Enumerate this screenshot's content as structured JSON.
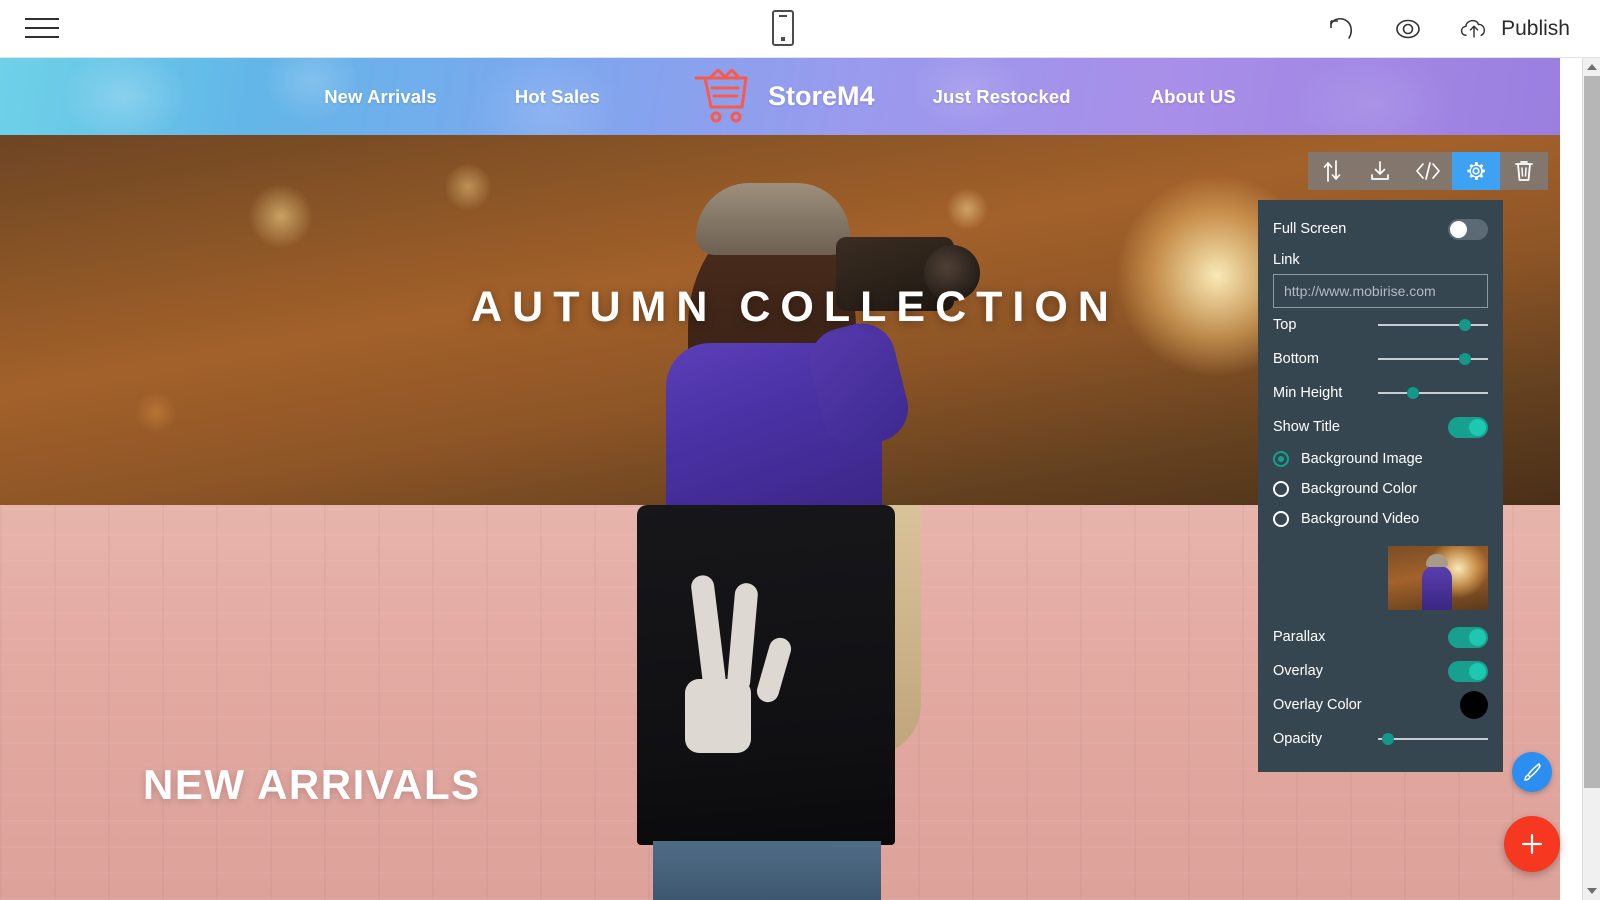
{
  "appbar": {
    "menu_icon": "hamburger-icon",
    "device_icon": "mobile-device-icon",
    "undo_icon": "undo-icon",
    "preview_icon": "eye-preview-icon",
    "publish_icon": "cloud-upload-icon",
    "publish_label": "Publish"
  },
  "sitenav": {
    "brand": "StoreM4",
    "brand_icon": "shopping-cart-icon",
    "brand_color": "#fb5a4a",
    "links_left": [
      "New Arrivals",
      "Hot Sales"
    ],
    "links_right": [
      "Just Restocked",
      "About US"
    ]
  },
  "hero": {
    "title": "AUTUMN COLLECTION",
    "selection_color": "#16a598"
  },
  "arrivals": {
    "title": "NEW ARRIVALS"
  },
  "block_toolbar": {
    "items": [
      {
        "name": "move-block-icon",
        "label": "Move Block",
        "active": false
      },
      {
        "name": "download-block-icon",
        "label": "Download Block",
        "active": false
      },
      {
        "name": "code-editor-icon",
        "label": "Edit Code",
        "active": false
      },
      {
        "name": "block-settings-gear-icon",
        "label": "Block Parameters",
        "active": true
      },
      {
        "name": "delete-block-trash-icon",
        "label": "Delete Block",
        "active": false
      }
    ],
    "active_color": "#3ea1f2"
  },
  "panel": {
    "full_screen": {
      "label": "Full Screen",
      "value": "off"
    },
    "link": {
      "label": "Link",
      "placeholder": "http://www.mobirise.com",
      "value": ""
    },
    "top": {
      "label": "Top",
      "percent": 83
    },
    "bottom": {
      "label": "Bottom",
      "percent": 83
    },
    "min_height": {
      "label": "Min Height",
      "percent": 30
    },
    "show_title": {
      "label": "Show Title",
      "value": "on"
    },
    "background_options": [
      {
        "label": "Background Image",
        "selected": true
      },
      {
        "label": "Background Color",
        "selected": false
      },
      {
        "label": "Background Video",
        "selected": false
      }
    ],
    "thumbnail_name": "background-image-thumbnail",
    "parallax": {
      "label": "Parallax",
      "value": "on"
    },
    "overlay": {
      "label": "Overlay",
      "value": "on"
    },
    "overlay_color": {
      "label": "Overlay Color",
      "color": "#000000"
    },
    "opacity": {
      "label": "Opacity",
      "percent": 4
    },
    "accent_color": "#14988a"
  },
  "fab": {
    "pen_icon": "pen-brush-icon",
    "pen_color": "#2b8ef0",
    "add_icon": "plus-icon",
    "add_color": "#f5381f"
  },
  "scrollbar": {
    "up_icon": "scroll-up-arrow-icon",
    "down_icon": "scroll-down-arrow-icon"
  }
}
